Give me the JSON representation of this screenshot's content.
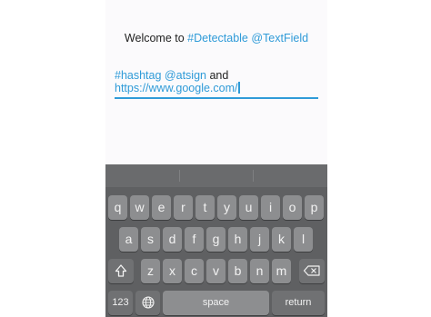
{
  "title": {
    "prefix": "Welcome to ",
    "highlight": "#Detectable @TextField"
  },
  "text_field": {
    "hashtag": "#hashtag",
    "space1": " ",
    "atsign": "@atsign",
    "plain": " and",
    "url": "https://www.google.com/"
  },
  "colors": {
    "accent": "#2f9bd8",
    "keyboard_bg": "#5f6062",
    "key_bg": "#8d8e90"
  },
  "keyboard": {
    "row1": [
      "q",
      "w",
      "e",
      "r",
      "t",
      "y",
      "u",
      "i",
      "o",
      "p"
    ],
    "row2": [
      "a",
      "s",
      "d",
      "f",
      "g",
      "h",
      "j",
      "k",
      "l"
    ],
    "row3": [
      "z",
      "x",
      "c",
      "v",
      "b",
      "n",
      "m"
    ],
    "numbers_label": "123",
    "space_label": "space",
    "return_label": "return",
    "shift_icon": "shift-icon",
    "backspace_icon": "backspace-icon",
    "globe_icon": "globe-icon"
  }
}
